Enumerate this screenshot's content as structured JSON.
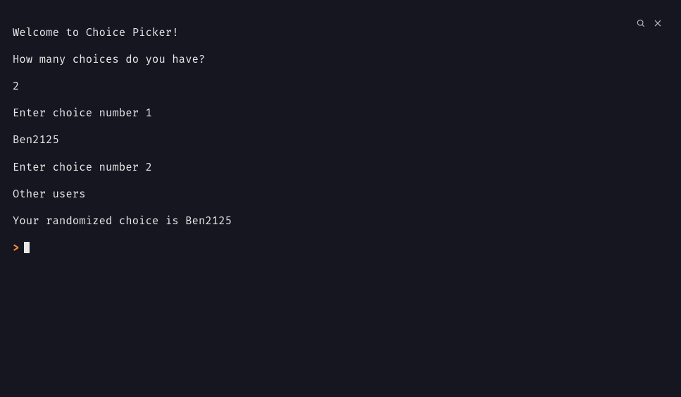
{
  "titlebar": {
    "search_icon": "search",
    "close_icon": "close"
  },
  "terminal": {
    "lines": [
      "Welcome to Choice Picker!",
      "How many choices do you have?",
      "2",
      "Enter choice number 1",
      "Ben2125",
      "Enter choice number 2",
      "Other users",
      "Your randomized choice is Ben2125"
    ],
    "prompt_symbol": ">"
  }
}
